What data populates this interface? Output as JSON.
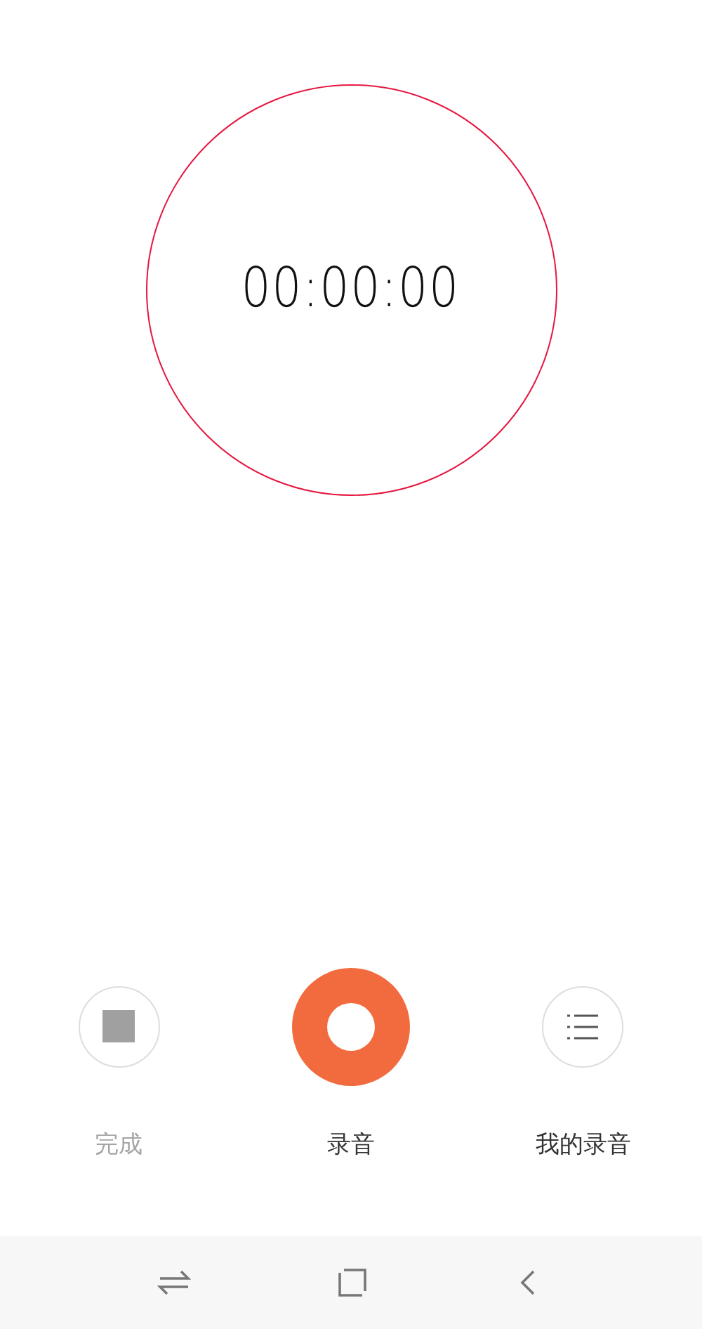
{
  "timer": {
    "time": "00:00:00"
  },
  "controls": [
    {
      "kind": "stop",
      "label": "完成",
      "disabled": true
    },
    {
      "kind": "record",
      "label": "录音",
      "disabled": false
    },
    {
      "kind": "list",
      "label": "我的录音",
      "disabled": false
    }
  ]
}
